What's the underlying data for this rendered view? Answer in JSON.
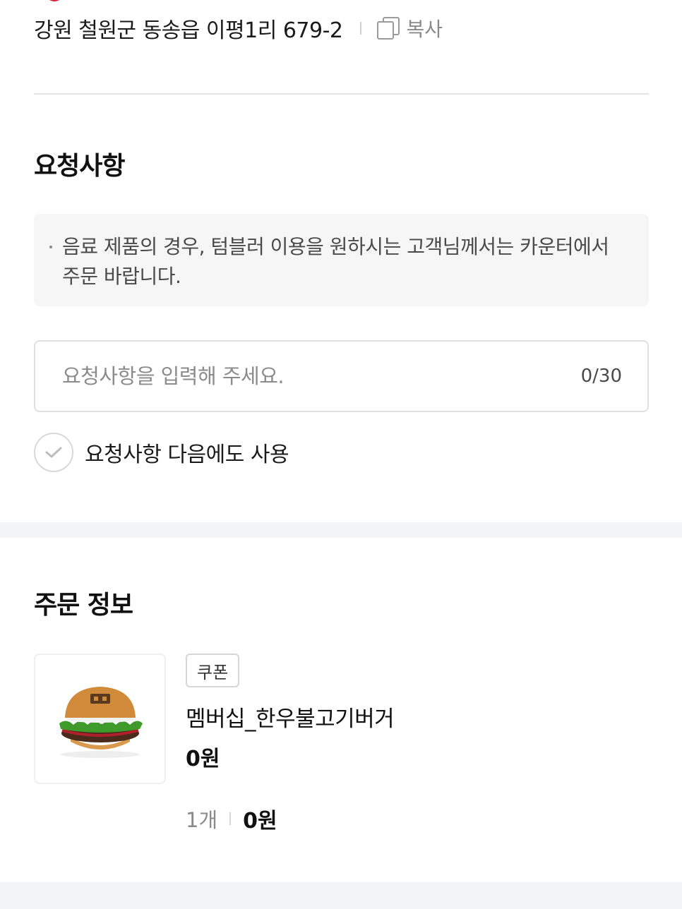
{
  "store": {
    "address": "강원 철원군 동송읍 이평1리 679-2",
    "copy_label": "복사"
  },
  "request_section": {
    "title": "요청사항",
    "notice_line1": "음료 제품의 경우, 텀블러 이용을 원하시는 고객님께서는 카운터에서",
    "notice_line2": "주문 바랍니다.",
    "input_placeholder": "요청사항을 입력해 주세요.",
    "input_value": "",
    "char_count": "0/30",
    "reuse_label": "요청사항 다음에도 사용",
    "reuse_checked": false
  },
  "order_section": {
    "title": "주문 정보",
    "item": {
      "badge": "쿠폰",
      "name": "멤버십_한우불고기버거",
      "price": "0원",
      "quantity": "1개",
      "total": "0원",
      "image": "burger-image"
    }
  },
  "colors": {
    "accent": "#d6233a",
    "band": "#f3f4f5",
    "notice_bg": "#f6f6f7"
  }
}
